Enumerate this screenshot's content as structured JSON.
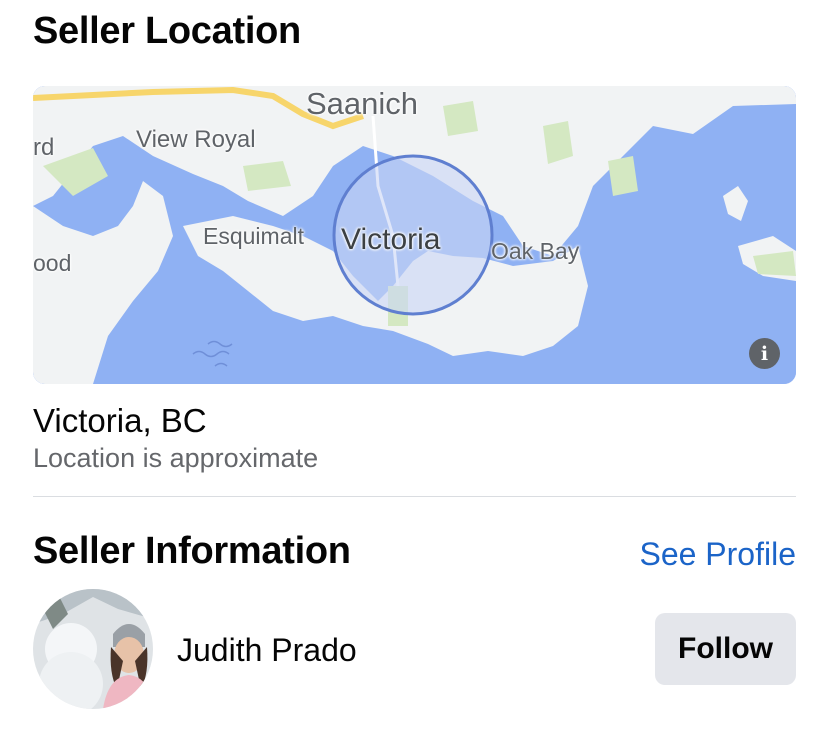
{
  "location": {
    "title": "Seller Location",
    "city": "Victoria, BC",
    "note": "Location is approximate",
    "map": {
      "labels": {
        "saanich": "Saanich",
        "view_royal": "View Royal",
        "esquimalt": "Esquimalt",
        "victoria": "Victoria",
        "oak_bay": "Oak Bay",
        "left_top": "rd",
        "left_mid": "ood"
      },
      "info_glyph": "i",
      "colors": {
        "water": "#8fb1f3",
        "land": "#f1f3f4",
        "park": "#d4e8c2",
        "highway": "#f7d56b",
        "radius_fill": "#c9d5f5",
        "radius_stroke": "#5f7fd0"
      }
    }
  },
  "seller": {
    "title": "Seller Information",
    "see_profile": "See Profile",
    "name": "Judith Prado",
    "follow": "Follow"
  },
  "colors": {
    "link": "#1b64c8",
    "secondary_text": "#65676b",
    "button_bg": "#e4e6eb"
  }
}
